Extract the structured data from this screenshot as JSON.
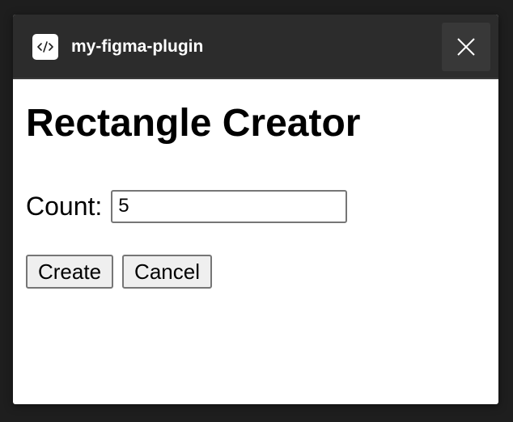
{
  "titlebar": {
    "title": "my-figma-plugin",
    "icon": "code-icon",
    "close_icon": "close-icon"
  },
  "main": {
    "heading": "Rectangle Creator",
    "count_label": "Count:",
    "count_value": "5",
    "create_label": "Create",
    "cancel_label": "Cancel"
  },
  "colors": {
    "background": "#1e1e1e",
    "titlebar": "#2c2c2c",
    "close_button": "#383838",
    "panel": "#ffffff"
  }
}
